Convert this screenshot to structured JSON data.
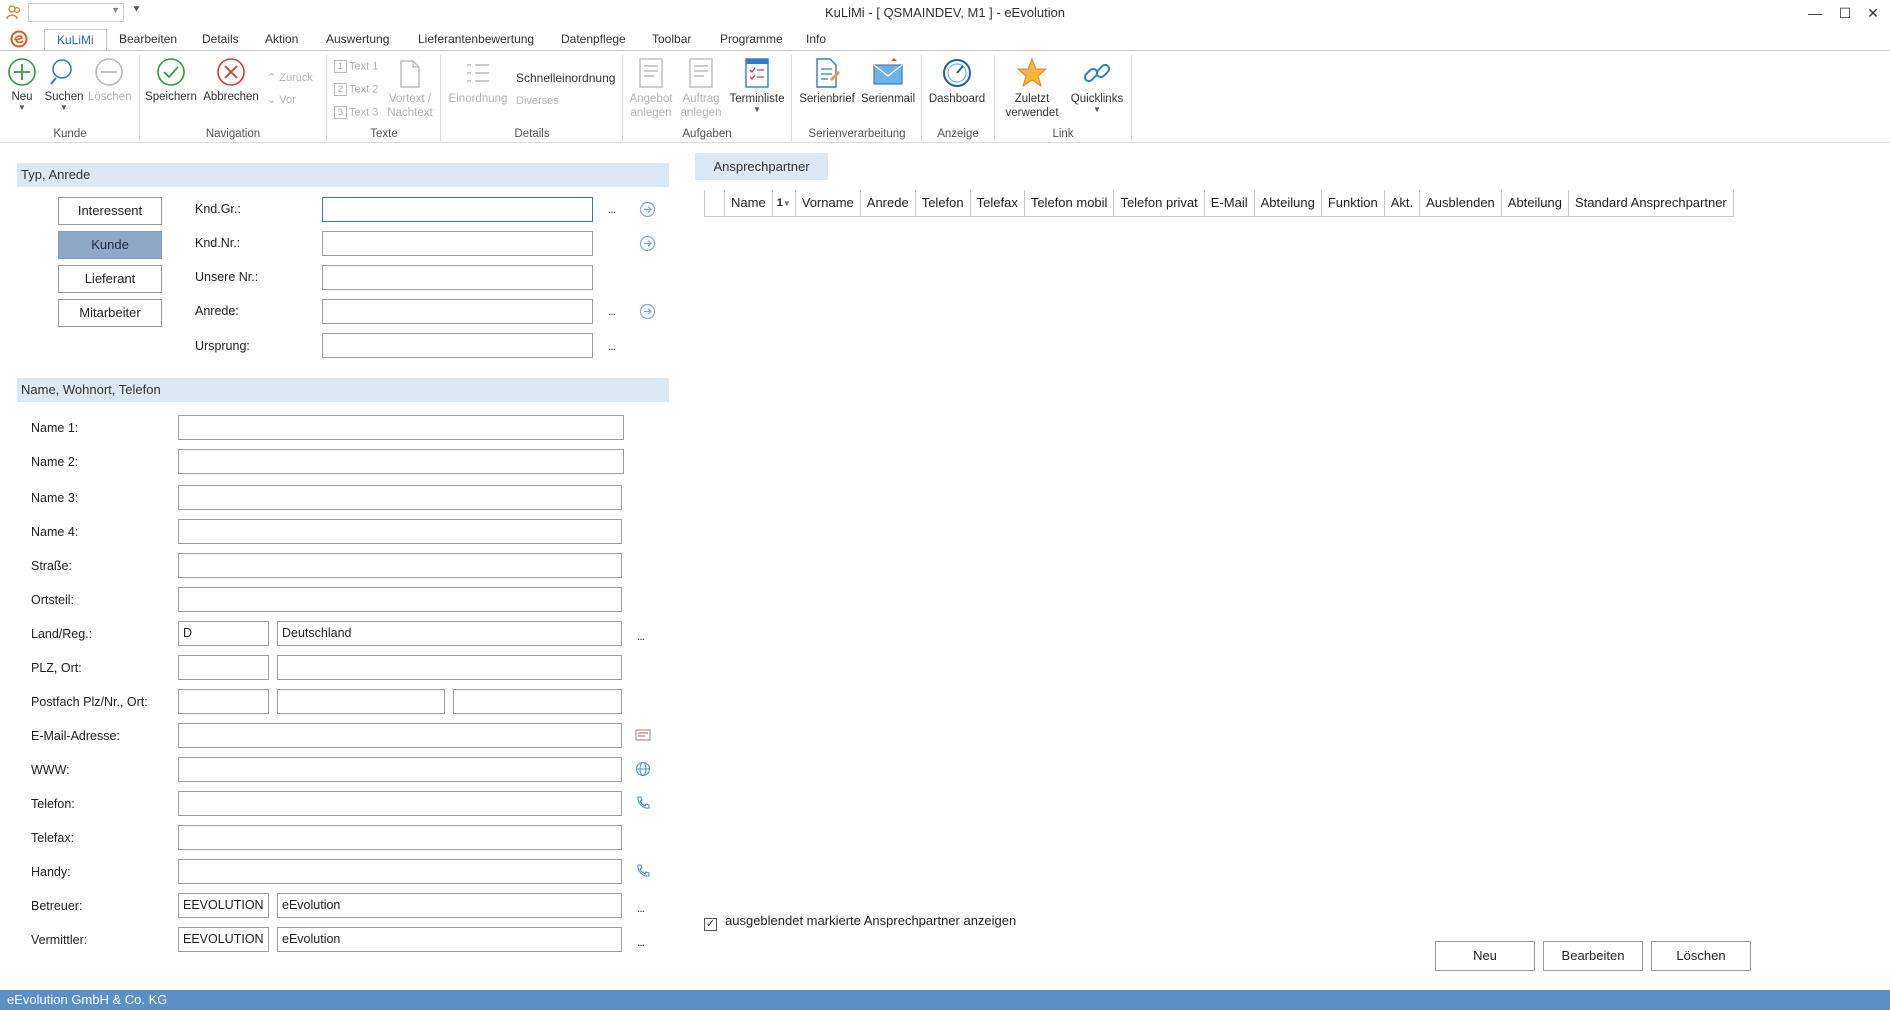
{
  "window": {
    "title": "KuLiMi - [ QSMAINDEV, M1 ]  -  eEvolution",
    "minimize": "—",
    "maximize": "☐",
    "close": "✕"
  },
  "menu_tabs": [
    "KuLiMi",
    "Bearbeiten",
    "Details",
    "Aktion",
    "Auswertung",
    "Lieferantenbewertung",
    "Datenpflege",
    "Toolbar",
    "Programme",
    "Info"
  ],
  "ribbon": {
    "kunde": {
      "label": "Kunde",
      "neu": "Neu",
      "suchen": "Suchen",
      "loeschen": "Löschen"
    },
    "navigation": {
      "label": "Navigation",
      "speichern": "Speichern",
      "abbrechen": "Abbrechen",
      "zurueck": "Zurück",
      "vor": "Vor"
    },
    "texte": {
      "label": "Texte",
      "text1": "Text 1",
      "text2": "Text 2",
      "text3": "Text 3",
      "vortext_1": "Vortext /",
      "vortext_2": "Nachtext"
    },
    "details": {
      "label": "Details",
      "einordnung": "Einordnung",
      "schnelleinordnung": "Schnelleinordnung",
      "diverses": "Diverses"
    },
    "aufgaben": {
      "label": "Aufgaben",
      "angebot_1": "Angebot",
      "angebot_2": "anlegen",
      "auftrag_1": "Auftrag",
      "auftrag_2": "anlegen",
      "terminliste": "Terminliste"
    },
    "serien": {
      "label": "Serienverarbeitung",
      "serienbrief": "Serienbrief",
      "serienmail": "Serienmail"
    },
    "anzeige": {
      "label": "Anzeige",
      "dashboard": "Dashboard"
    },
    "link": {
      "label": "Link",
      "zuletzt_1": "Zuletzt",
      "zuletzt_2": "verwendet",
      "quicklinks": "Quicklinks"
    }
  },
  "type_section": {
    "header": "Typ, Anrede",
    "buttons": [
      "Interessent",
      "Kunde",
      "Lieferant",
      "Mitarbeiter"
    ],
    "selected": "Kunde",
    "fields": [
      {
        "label": "Knd.Gr.:",
        "value": ""
      },
      {
        "label": "Knd.Nr.:",
        "value": ""
      },
      {
        "label": "Unsere Nr.:",
        "value": ""
      },
      {
        "label": "Anrede:",
        "value": ""
      },
      {
        "label": "Ursprung:",
        "value": ""
      }
    ]
  },
  "name_section": {
    "header": "Name, Wohnort, Telefon",
    "labels": {
      "name1": "Name 1:",
      "name2": "Name 2:",
      "name3": "Name 3:",
      "name4": "Name 4:",
      "strasse": "Straße:",
      "ortsteil": "Ortsteil:",
      "land": "Land/Reg.:",
      "plz": "PLZ, Ort:",
      "postfach": "Postfach Plz/Nr., Ort:",
      "email": "E-Mail-Adresse:",
      "www": "WWW:",
      "telefon": "Telefon:",
      "telefax": "Telefax:",
      "handy": "Handy:",
      "betreuer": "Betreuer:",
      "vermittler": "Vermittler:"
    },
    "values": {
      "land_code": "D",
      "land_name": "Deutschland",
      "betreuer_code": "EEVOLUTION",
      "betreuer_name": "eEvolution",
      "vermittler_code": "EEVOLUTION",
      "vermittler_name": "eEvolution"
    }
  },
  "ansprechpartner": {
    "tab": "Ansprechpartner",
    "sort_indicator": "1",
    "columns": [
      "Name",
      "Vorname",
      "Anrede",
      "Telefon",
      "Telefax",
      "Telefon mobil",
      "Telefon privat",
      "E-Mail",
      "Abteilung",
      "Funktion",
      "Akt.",
      "Ausblenden",
      "Abteilung",
      "Standard Ansprechpartner"
    ],
    "checkbox_label": "ausgeblendet markierte Ansprechpartner anzeigen",
    "checkbox_checked": true,
    "check_mark": "✓",
    "buttons": {
      "neu": "Neu",
      "bearbeiten": "Bearbeiten",
      "loeschen": "Löschen"
    }
  },
  "ellipsis": "...",
  "status_bar": "eEvolution GmbH & Co. KG",
  "colors": {
    "accent": "#2b6cb0",
    "section_bg": "#dce9f4",
    "selected_btn": "#8ea8c8",
    "statusbar": "#5b8fc7"
  }
}
